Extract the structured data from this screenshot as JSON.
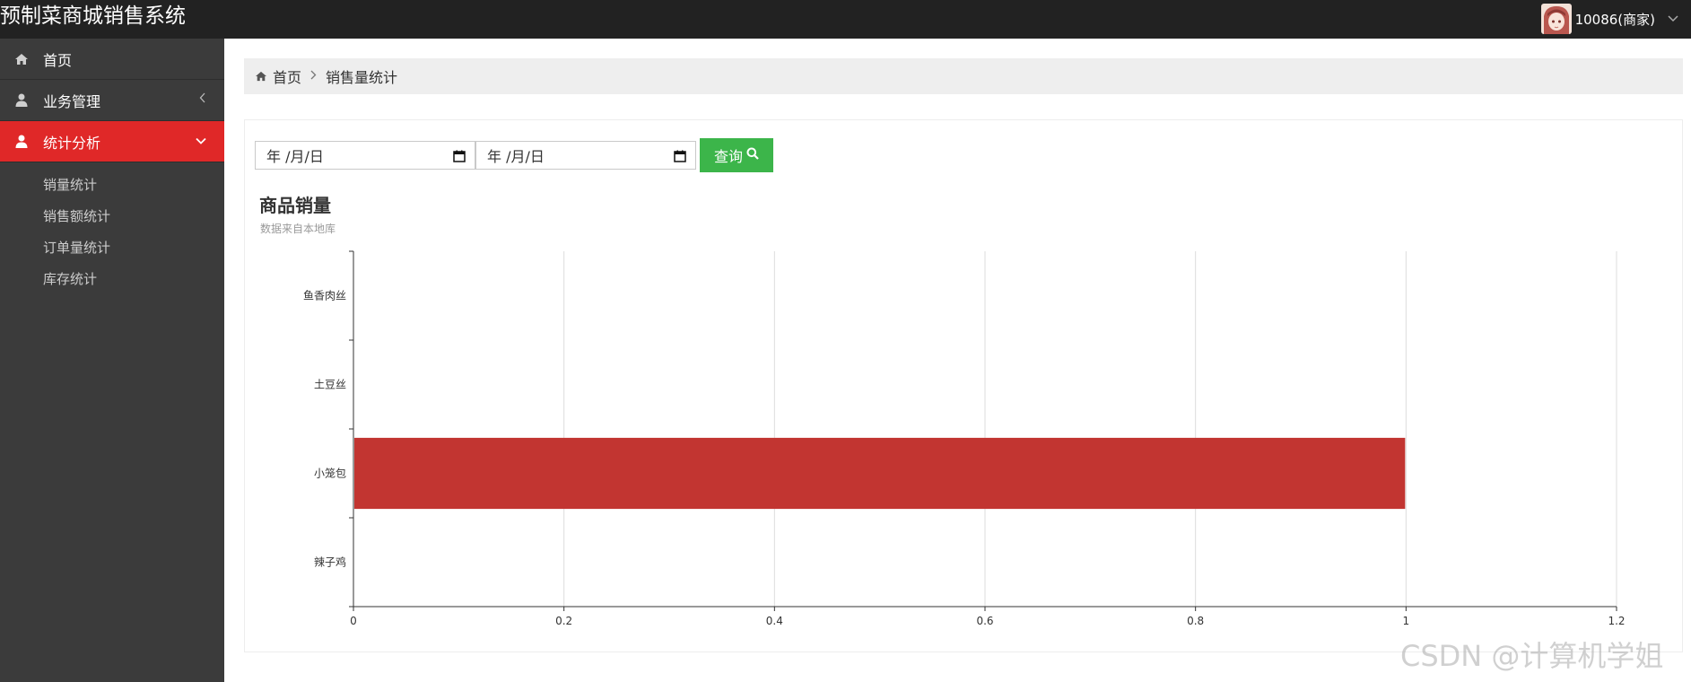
{
  "app": {
    "title": "预制菜商城销售系统"
  },
  "user": {
    "name": "10086(商家)"
  },
  "sidebar": {
    "items": [
      {
        "label": "首页",
        "icon": "home-icon"
      },
      {
        "label": "业务管理",
        "icon": "user-icon"
      },
      {
        "label": "统计分析",
        "icon": "user-icon"
      }
    ],
    "submenu": [
      "销量统计",
      "销售额统计",
      "订单量统计",
      "库存统计"
    ]
  },
  "breadcrumb": {
    "home": "首页",
    "current": "销售量统计"
  },
  "filters": {
    "start_date": "年 /月/日",
    "end_date": "年 /月/日",
    "query_label": "查询"
  },
  "colors": {
    "accent": "#e02828",
    "bar": "#c23531",
    "query": "#3cb54a"
  },
  "chart_data": {
    "type": "bar",
    "orientation": "horizontal",
    "title": "商品销量",
    "subtitle": "数据来自本地库",
    "categories": [
      "鱼香肉丝",
      "土豆丝",
      "小笼包",
      "辣子鸡"
    ],
    "values": [
      0,
      0,
      1,
      0
    ],
    "xlim": [
      0,
      1.2
    ],
    "xticks": [
      "0",
      "0.2",
      "0.4",
      "0.6",
      "0.8",
      "1",
      "1.2"
    ],
    "grid": true
  },
  "watermark": "CSDN @计算机学姐"
}
